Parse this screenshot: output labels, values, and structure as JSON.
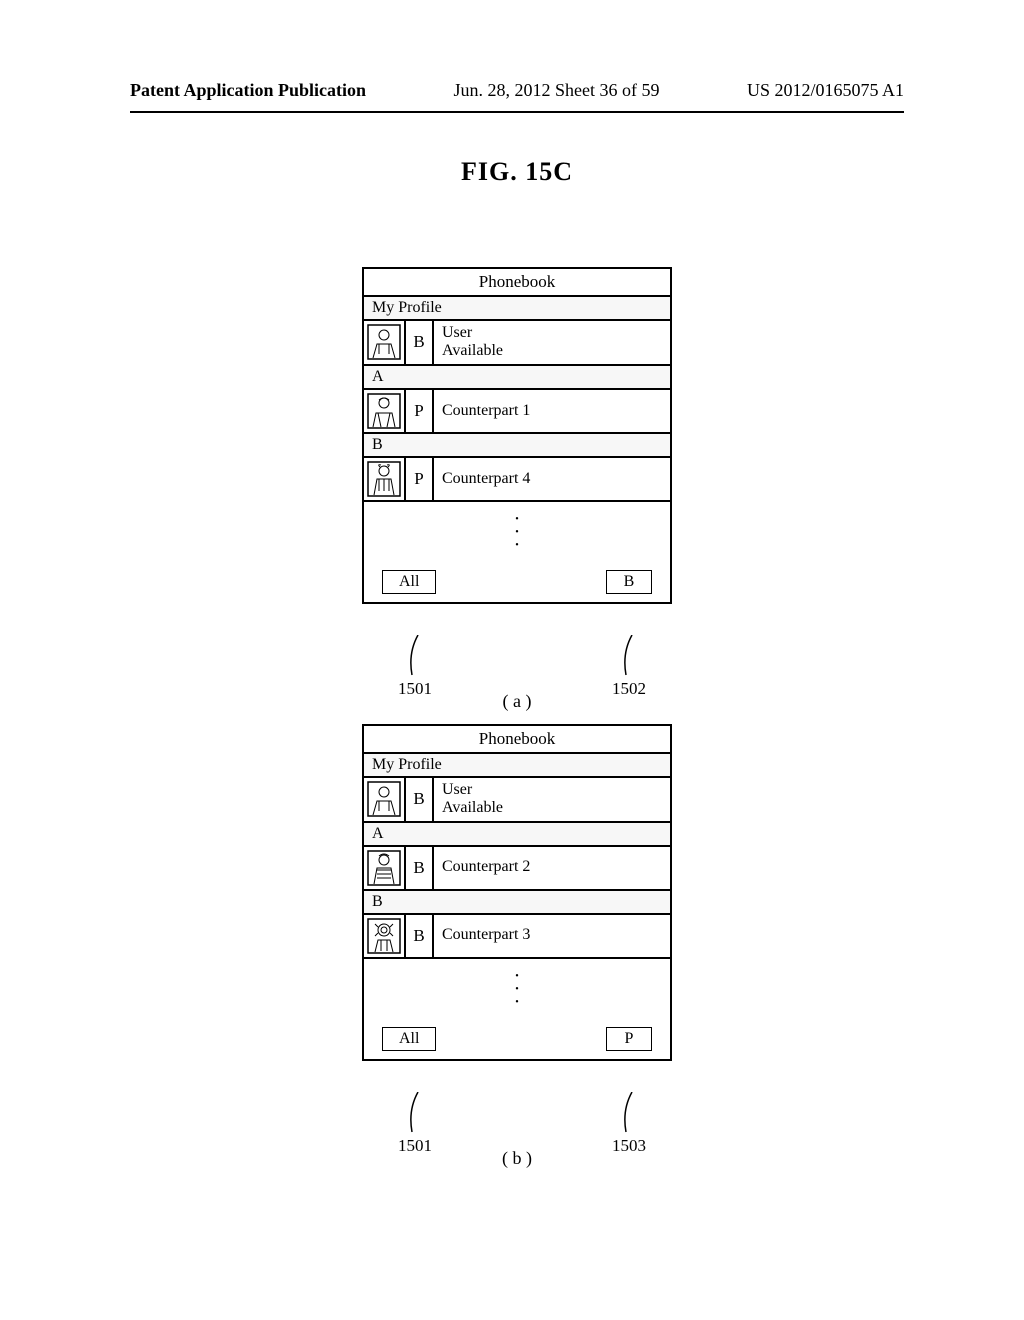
{
  "header": {
    "left": "Patent Application Publication",
    "mid": "Jun. 28, 2012  Sheet 36 of 59",
    "right": "US 2012/0165075 A1"
  },
  "figure_title": "FIG. 15C",
  "screens": {
    "a": {
      "title": "Phonebook",
      "profile_section": "My Profile",
      "profile_tag": "B",
      "profile_name": "User",
      "profile_status": "Available",
      "group1": "A",
      "entry1_tag": "P",
      "entry1_name": "Counterpart 1",
      "group2": "B",
      "entry2_tag": "P",
      "entry2_name": "Counterpart 4",
      "btn_left": "All",
      "btn_right": "B",
      "ref_left": "1501",
      "ref_right": "1502",
      "sub": "( a )"
    },
    "b": {
      "title": "Phonebook",
      "profile_section": "My Profile",
      "profile_tag": "B",
      "profile_name": "User",
      "profile_status": "Available",
      "group1": "A",
      "entry1_tag": "B",
      "entry1_name": "Counterpart 2",
      "group2": "B",
      "entry2_tag": "B",
      "entry2_name": "Counterpart 3",
      "btn_left": "All",
      "btn_right": "P",
      "ref_left": "1501",
      "ref_right": "1503",
      "sub": "( b )"
    }
  }
}
